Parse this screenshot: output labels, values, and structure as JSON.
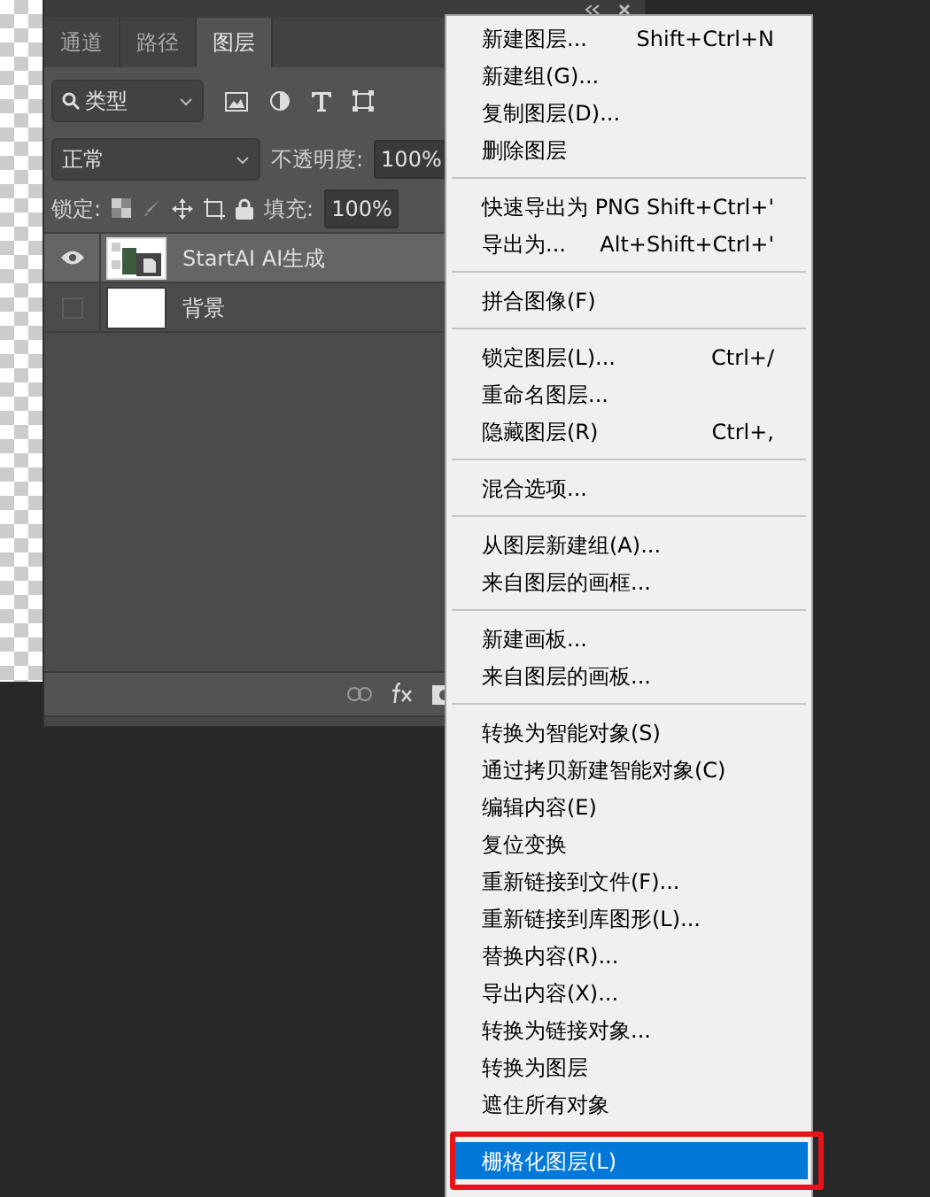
{
  "panel": {
    "tabs": [
      {
        "label": "通道",
        "selected": false
      },
      {
        "label": "路径",
        "selected": false
      },
      {
        "label": "图层",
        "selected": true
      }
    ],
    "filter": {
      "value": "类型"
    },
    "blend_mode": {
      "value": "正常"
    },
    "opacity": {
      "label": "不透明度:",
      "value": "100%"
    },
    "lock": {
      "label": "锁定:"
    },
    "fill": {
      "label": "填充:",
      "value": "100%"
    },
    "layers": [
      {
        "name": "StartAI AI生成",
        "kind": "smart",
        "visible": true,
        "selected": true
      },
      {
        "name": "背景",
        "kind": "plain",
        "visible": false,
        "selected": false
      }
    ]
  },
  "context_menu": {
    "sections": [
      {
        "items": [
          {
            "label": "新建图层...",
            "shortcut": "Shift+Ctrl+N",
            "selected": false
          },
          {
            "label": "新建组(G)...",
            "selected": false
          },
          {
            "label": "复制图层(D)...",
            "selected": false
          },
          {
            "label": "删除图层",
            "selected": false
          }
        ]
      },
      {
        "items": [
          {
            "label": "快速导出为 PNG",
            "shortcut": "Shift+Ctrl+'",
            "selected": false
          },
          {
            "label": "导出为...",
            "shortcut": "Alt+Shift+Ctrl+'",
            "selected": false
          }
        ]
      },
      {
        "items": [
          {
            "label": "拼合图像(F)",
            "selected": false
          }
        ]
      },
      {
        "items": [
          {
            "label": "锁定图层(L)...",
            "shortcut": "Ctrl+/",
            "selected": false
          },
          {
            "label": "重命名图层...",
            "selected": false
          },
          {
            "label": "隐藏图层(R)",
            "shortcut": "Ctrl+,",
            "selected": false
          }
        ]
      },
      {
        "items": [
          {
            "label": "混合选项...",
            "selected": false
          }
        ]
      },
      {
        "items": [
          {
            "label": "从图层新建组(A)...",
            "selected": false
          },
          {
            "label": "来自图层的画框...",
            "selected": false
          }
        ]
      },
      {
        "items": [
          {
            "label": "新建画板...",
            "selected": false
          },
          {
            "label": "来自图层的画板...",
            "selected": false
          }
        ]
      },
      {
        "items": [
          {
            "label": "转换为智能对象(S)",
            "selected": false
          },
          {
            "label": "通过拷贝新建智能对象(C)",
            "selected": false
          },
          {
            "label": "编辑内容(E)",
            "selected": false
          },
          {
            "label": "复位变换",
            "selected": false
          },
          {
            "label": "重新链接到文件(F)...",
            "selected": false
          },
          {
            "label": "重新链接到库图形(L)...",
            "selected": false
          },
          {
            "label": "替换内容(R)...",
            "selected": false
          },
          {
            "label": "导出内容(X)...",
            "selected": false
          },
          {
            "label": "转换为链接对象...",
            "selected": false
          },
          {
            "label": "转换为图层",
            "selected": false
          },
          {
            "label": "遮住所有对象",
            "selected": false
          }
        ]
      },
      {
        "items": [
          {
            "label": "栅格化图层(L)",
            "selected": true,
            "annotated": true
          }
        ]
      }
    ]
  }
}
